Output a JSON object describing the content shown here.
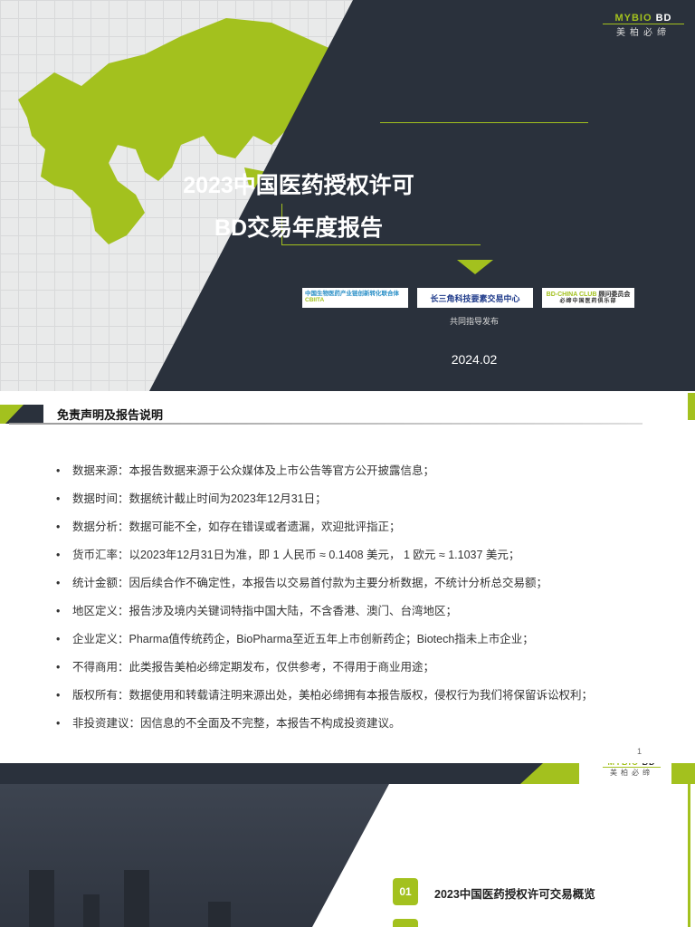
{
  "brand": {
    "logo_latin": "MYBIO",
    "logo_suffix": "BD",
    "logo_cn": "美柏必缔"
  },
  "cover": {
    "title_line1": "2023中国医药授权许可",
    "title_line2": "BD交易年度报告",
    "partners": [
      {
        "name": "中国生物医药产业链创新转化联合体",
        "abbr": "CBIITA"
      },
      {
        "name": "长三角科技要素交易中心"
      },
      {
        "name": "BD-CHINA CLUB",
        "extra": "顾问委员会",
        "sub": "必缔中国医药俱乐部"
      }
    ],
    "copublished": "共同指导发布",
    "date": "2024.02"
  },
  "disclaimer": {
    "heading": "免责声明及报告说明",
    "items": [
      "数据来源：本报告数据来源于公众媒体及上市公告等官方公开披露信息；",
      "数据时间：数据统计截止时间为2023年12月31日；",
      "数据分析：数据可能不全，如存在错误或者遗漏，欢迎批评指正；",
      "货币汇率：以2023年12月31日为准，即 1 人民币 ≈ 0.1408 美元， 1 欧元 ≈ 1.1037 美元；",
      "统计金额：因后续合作不确定性，本报告以交易首付款为主要分析数据，不统计分析总交易额；",
      "地区定义：报告涉及境内关键词特指中国大陆，不含香港、澳门、台湾地区；",
      "企业定义：Pharma值传统药企，BioPharma至近五年上市创新药企；Biotech指未上市企业；",
      "不得商用：此类报告美柏必缔定期发布，仅供参考，不得用于商业用途；",
      "版权所有：数据使用和转载请注明来源出处，美柏必缔拥有本报告版权，侵权行为我们将保留诉讼权利；",
      "非投资建议：因信息的不全面及不完整，本报告不构成投资建议。"
    ],
    "page_number": "1"
  },
  "toc": {
    "items": [
      {
        "num": "01",
        "label": "2023中国医药授权许可交易概览"
      }
    ]
  },
  "colors": {
    "accent": "#a3c11e",
    "dark": "#2a313c"
  }
}
